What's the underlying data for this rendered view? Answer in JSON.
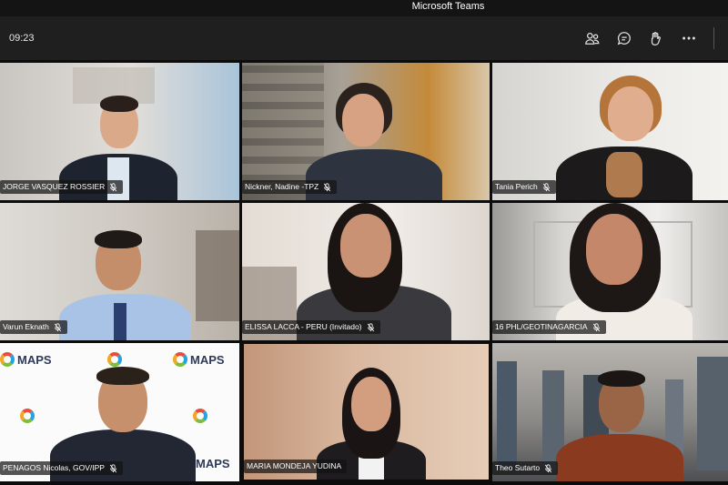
{
  "window": {
    "title": "Microsoft Teams"
  },
  "toolbar": {
    "timer": "09:23",
    "icons": [
      "participants-icon",
      "chat-icon",
      "raise-hand-icon",
      "more-options-icon"
    ]
  },
  "participants": [
    {
      "name": "JORGE VASQUEZ ROSSIER",
      "muted": true
    },
    {
      "name": "Nickner, Nadine -TPZ",
      "muted": true
    },
    {
      "name": "Tania Perich",
      "muted": true
    },
    {
      "name": "Varun Eknath",
      "muted": true
    },
    {
      "name": "ELISSA LACCA - PERU (Invitado)",
      "muted": true
    },
    {
      "name": "16 PHL/GEOTINAGARCIA",
      "muted": true
    },
    {
      "name": "PENAGOS Nicolas, GOV/IPP",
      "muted": true
    },
    {
      "name": "MARIA MONDEJA YUDINA",
      "muted": false,
      "active": true
    },
    {
      "name": "Theo Sutarto",
      "muted": true
    }
  ],
  "backdrop": {
    "logo_text": "MAPS"
  },
  "colors": {
    "active_border": "#8b8cc7",
    "toolbar_bg": "#1f1f1f",
    "titlebar_bg": "#141414"
  }
}
